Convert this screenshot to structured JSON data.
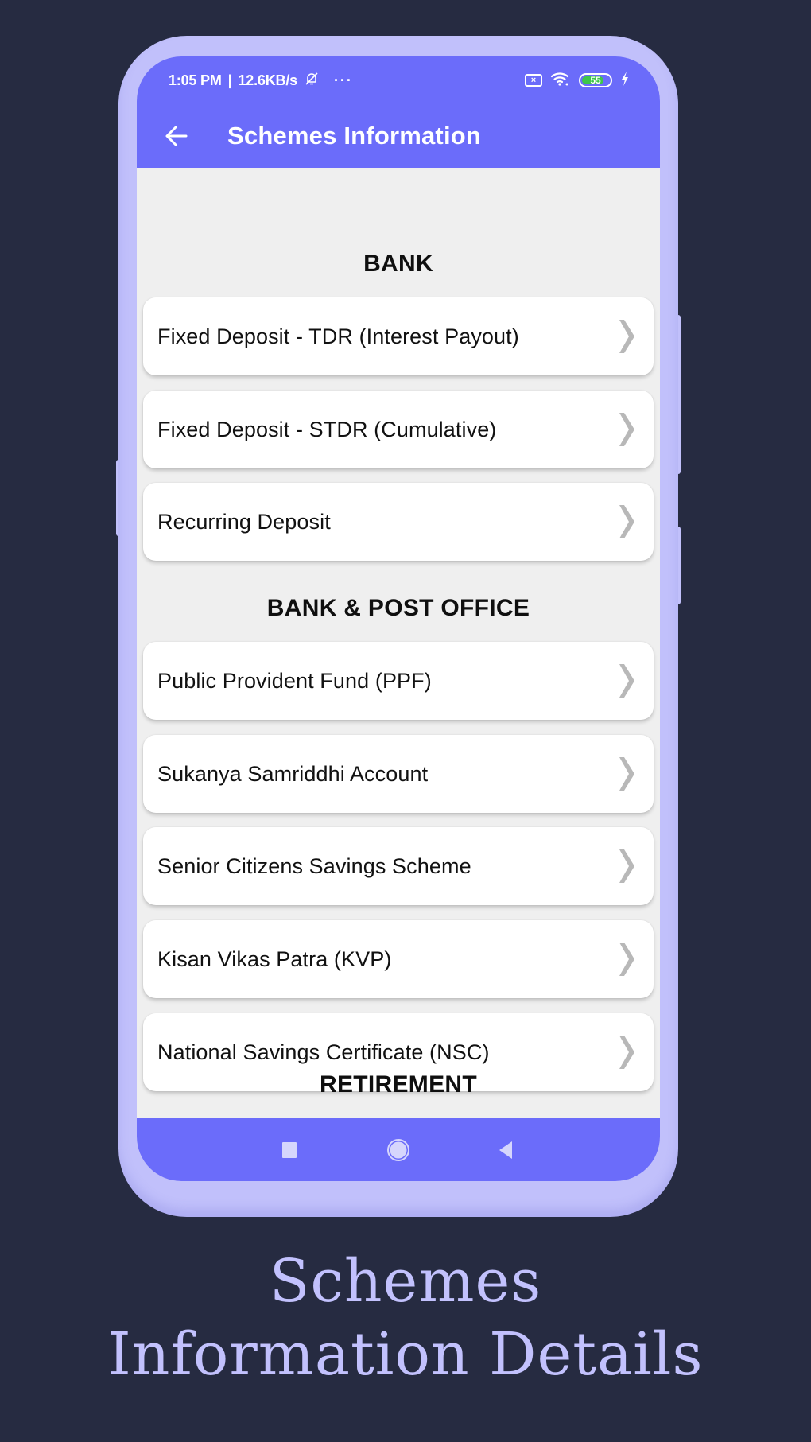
{
  "status_bar": {
    "time": "1:05 PM",
    "separator": "|",
    "network_speed": "12.6KB/s",
    "more_indicator": "···",
    "icons": [
      "bell-muted-icon",
      "sim-off-icon",
      "wifi-icon",
      "battery-icon",
      "charging-icon"
    ],
    "sim_glyph": "×",
    "battery_percent": "55",
    "battery_level": 0.55
  },
  "app_bar": {
    "back_icon": "arrow-left-icon",
    "title": "Schemes Information"
  },
  "sections": [
    {
      "title": "BANK",
      "items": [
        {
          "label": "Fixed Deposit - TDR (Interest Payout)"
        },
        {
          "label": "Fixed Deposit - STDR (Cumulative)"
        },
        {
          "label": "Recurring Deposit"
        }
      ]
    },
    {
      "title": "BANK & POST OFFICE",
      "items": [
        {
          "label": "Public Provident Fund (PPF)"
        },
        {
          "label": "Sukanya Samriddhi Account"
        },
        {
          "label": "Senior Citizens Savings Scheme"
        },
        {
          "label": "Kisan Vikas Patra (KVP)"
        },
        {
          "label": "National Savings Certificate (NSC)"
        }
      ]
    },
    {
      "title": "RETIREMENT",
      "items": []
    }
  ],
  "nav_bar": {
    "buttons": [
      "recents-square-icon",
      "home-circle-icon",
      "back-triangle-icon"
    ]
  },
  "caption": {
    "line1": "Schemes",
    "line2": "Information Details"
  },
  "colors": {
    "background": "#262b41",
    "phone_frame": "#c1c0fb",
    "accent": "#6b6cfa",
    "screen_bg": "#efefef",
    "chevron": "#b8b8b8",
    "caption": "#c2c1fd"
  }
}
